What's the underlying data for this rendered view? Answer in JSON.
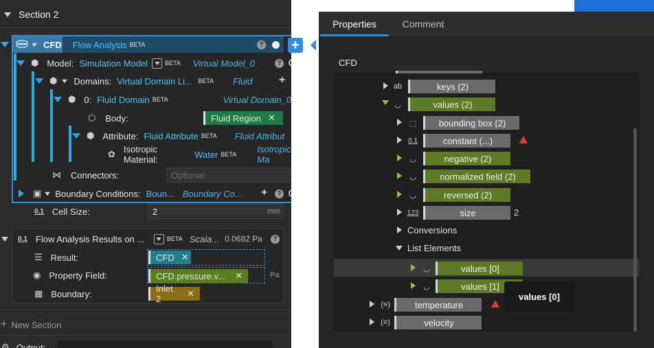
{
  "section": {
    "title": "Section 2"
  },
  "flow": {
    "short": "CFD",
    "name": "Flow Analysis",
    "beta": "BETA"
  },
  "model": {
    "label": "Model:",
    "value": "Simulation Model",
    "beta": "BETA",
    "ref": "Virtual Model_0"
  },
  "domains": {
    "label": "Domains:",
    "value": "Virtual Domain Li...",
    "beta": "BETA",
    "ref": "Fluid"
  },
  "domain0": {
    "index": "0:",
    "value": "Fluid Domain",
    "beta": "BETA",
    "ref": "Virtual Domain_0"
  },
  "body": {
    "label": "Body:",
    "chip": "Fluid Region"
  },
  "attribute": {
    "label": "Attribute:",
    "value": "Fluid Attribute",
    "beta": "BETA",
    "ref": "Fluid Attribut"
  },
  "material": {
    "label": "Isotropic Material:",
    "value": "Water",
    "beta": "BETA",
    "ref": "Isotropic Ma"
  },
  "connectors": {
    "label": "Connectors:",
    "placeholder": "Optional"
  },
  "boundary": {
    "label": "Boundary Conditions:",
    "value": "Boun...",
    "ref": "Boundary Con..."
  },
  "cell": {
    "icon": "0.1",
    "label": "Cell Size:",
    "value": "2",
    "unit": "mm"
  },
  "results": {
    "icon": "0.1",
    "title": "Flow Analysis Results on ...",
    "beta": "BETA",
    "ref": "Scala...",
    "value": "0.0682 Pa"
  },
  "result": {
    "label": "Result:",
    "chip": "CFD"
  },
  "property": {
    "label": "Property Field:",
    "chip": "CFD.pressure.v...",
    "unit": "Pa"
  },
  "boundaryField": {
    "label": "Boundary:",
    "chip": "Inlet 2"
  },
  "newSection": {
    "label": "New Section"
  },
  "output": {
    "label": "Output:"
  },
  "tabs": {
    "properties": "Properties",
    "comment": "Comment"
  },
  "tree": {
    "header": "CFD",
    "keys": "keys (2)",
    "values": "values (2)",
    "bbox": "bounding box (2)",
    "constant": "constant (...)",
    "negative": "negative (2)",
    "normalized": "normalized field (2)",
    "reversed": "reversed (2)",
    "size": "size",
    "sizeValue": "2",
    "conversions": "Conversions",
    "listElements": "List Elements",
    "values0": "values [0]",
    "values1": "values [1]",
    "temperature": "temperature",
    "velocity": "velocity",
    "tooltip": "values [0]"
  },
  "colors": {
    "accent": "#2ea8e0",
    "green": "#5f7a26",
    "chip_teal": "#1f7f8c",
    "chip_olive": "#5a7d1e",
    "chip_gold": "#8a6d14",
    "warn": "#e53935"
  }
}
